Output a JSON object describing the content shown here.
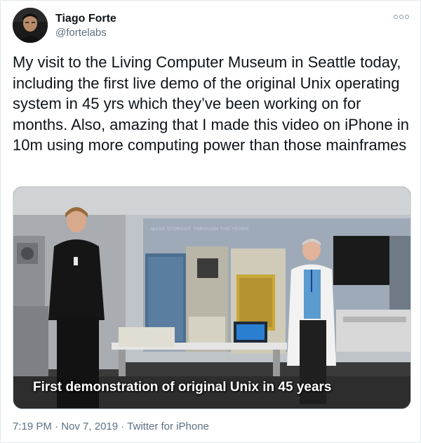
{
  "author": {
    "display_name": "Tiago Forte",
    "handle": "@fortelabs",
    "avatar_icon": "profile-photo"
  },
  "more_icon": "more-options-icon",
  "tweet": {
    "text": "My visit to the Living Computer Museum in Seattle today, including the first live demo of the original Unix operating system in 45 yrs which they’ve been working on for months. Also, amazing that I made this video on iPhone in 10m using more computing power than those mainframes"
  },
  "media": {
    "caption": "First demonstration of original Unix in 45 years",
    "wall_label": "MASS STORAGE THROUGH THE YEARS"
  },
  "meta": {
    "time": "7:19 PM",
    "separator_1": " · ",
    "date": "Nov 7, 2019",
    "separator_2": " · ",
    "source": "Twitter for iPhone"
  },
  "colors": {
    "text": "#0f1419",
    "secondary": "#5b7083",
    "border": "#cfd9de"
  }
}
